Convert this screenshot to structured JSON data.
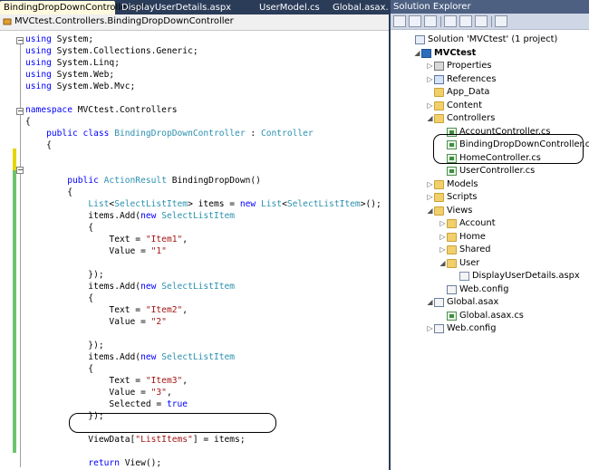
{
  "editor": {
    "tabs": [
      {
        "label": "BindingDropDownController.cs*",
        "active": true,
        "close": "×"
      },
      {
        "label": "DisplayUserDetails.aspx",
        "active": false
      },
      {
        "label": "UserModel.cs",
        "active": false
      },
      {
        "label": "Global.asax.cs",
        "active": false
      }
    ],
    "nav_path": "MVCtest.Controllers.BindingDropDownController",
    "code_lines": [
      [
        [
          "kw",
          "using"
        ],
        [
          "",
          " System;"
        ]
      ],
      [
        [
          "kw",
          "using"
        ],
        [
          "",
          " System.Collections.Generic;"
        ]
      ],
      [
        [
          "kw",
          "using"
        ],
        [
          "",
          " System.Linq;"
        ]
      ],
      [
        [
          "kw",
          "using"
        ],
        [
          "",
          " System.Web;"
        ]
      ],
      [
        [
          "kw",
          "using"
        ],
        [
          "",
          " System.Web.Mvc;"
        ]
      ],
      [],
      [
        [
          "kw",
          "namespace"
        ],
        [
          "",
          " MVCtest.Controllers"
        ]
      ],
      [
        [
          "",
          "{"
        ]
      ],
      [
        [
          "",
          "    "
        ],
        [
          "kw",
          "public class"
        ],
        [
          "",
          " "
        ],
        [
          "ty",
          "BindingDropDownController"
        ],
        [
          "",
          " : "
        ],
        [
          "ty",
          "Controller"
        ]
      ],
      [
        [
          "",
          "    {"
        ]
      ],
      [],
      [],
      [
        [
          "",
          "        "
        ],
        [
          "kw",
          "public"
        ],
        [
          "",
          " "
        ],
        [
          "ty",
          "ActionResult"
        ],
        [
          "",
          " BindingDropDown()"
        ]
      ],
      [
        [
          "",
          "        {"
        ]
      ],
      [
        [
          "",
          "            "
        ],
        [
          "ty",
          "List"
        ],
        [
          "",
          "<"
        ],
        [
          "ty",
          "SelectListItem"
        ],
        [
          "",
          "> items = "
        ],
        [
          "kw",
          "new"
        ],
        [
          "",
          " "
        ],
        [
          "ty",
          "List"
        ],
        [
          "",
          "<"
        ],
        [
          "ty",
          "SelectListItem"
        ],
        [
          "",
          ">();"
        ]
      ],
      [
        [
          "",
          "            items.Add("
        ],
        [
          "kw",
          "new"
        ],
        [
          "",
          " "
        ],
        [
          "ty",
          "SelectListItem"
        ]
      ],
      [
        [
          "",
          "            {"
        ]
      ],
      [
        [
          "",
          "                Text = "
        ],
        [
          "st",
          "\"Item1\""
        ],
        [
          "",
          ","
        ]
      ],
      [
        [
          "",
          "                Value = "
        ],
        [
          "st",
          "\"1\""
        ]
      ],
      [],
      [
        [
          "",
          "            });"
        ]
      ],
      [
        [
          "",
          "            items.Add("
        ],
        [
          "kw",
          "new"
        ],
        [
          "",
          " "
        ],
        [
          "ty",
          "SelectListItem"
        ]
      ],
      [
        [
          "",
          "            {"
        ]
      ],
      [
        [
          "",
          "                Text = "
        ],
        [
          "st",
          "\"Item2\""
        ],
        [
          "",
          ","
        ]
      ],
      [
        [
          "",
          "                Value = "
        ],
        [
          "st",
          "\"2\""
        ]
      ],
      [],
      [
        [
          "",
          "            });"
        ]
      ],
      [
        [
          "",
          "            items.Add("
        ],
        [
          "kw",
          "new"
        ],
        [
          "",
          " "
        ],
        [
          "ty",
          "SelectListItem"
        ]
      ],
      [
        [
          "",
          "            {"
        ]
      ],
      [
        [
          "",
          "                Text = "
        ],
        [
          "st",
          "\"Item3\""
        ],
        [
          "",
          ","
        ]
      ],
      [
        [
          "",
          "                Value = "
        ],
        [
          "st",
          "\"3\""
        ],
        [
          "",
          ","
        ]
      ],
      [
        [
          "",
          "                Selected = "
        ],
        [
          "kw",
          "true"
        ]
      ],
      [
        [
          "",
          "            });"
        ]
      ],
      [],
      [
        [
          "",
          "            ViewData["
        ],
        [
          "st",
          "\"ListItems\""
        ],
        [
          "",
          "] = items;"
        ]
      ],
      [],
      [
        [
          "",
          "            "
        ],
        [
          "kw",
          "return"
        ],
        [
          "",
          " View();"
        ]
      ],
      [
        [
          "",
          "        }"
        ]
      ]
    ]
  },
  "solution_explorer": {
    "title": "Solution Explorer",
    "nodes": [
      {
        "label": "Solution 'MVCtest' (1 project)",
        "icon": "sln",
        "expander": ""
      },
      {
        "label": "MVCtest",
        "icon": "proj",
        "expander": "◢",
        "bold": true
      },
      {
        "label": "Properties",
        "icon": "props",
        "expander": "▷"
      },
      {
        "label": "References",
        "icon": "refs",
        "expander": "▷"
      },
      {
        "label": "App_Data",
        "icon": "folder",
        "expander": ""
      },
      {
        "label": "Content",
        "icon": "folder",
        "expander": "▷"
      },
      {
        "label": "Controllers",
        "icon": "folder",
        "expander": "◢"
      },
      {
        "label": "AccountController.cs",
        "icon": "cs",
        "expander": ""
      },
      {
        "label": "BindingDropDownController.cs",
        "icon": "cs",
        "expander": ""
      },
      {
        "label": "HomeController.cs",
        "icon": "cs",
        "expander": ""
      },
      {
        "label": "UserController.cs",
        "icon": "cs",
        "expander": ""
      },
      {
        "label": "Models",
        "icon": "folder",
        "expander": "▷"
      },
      {
        "label": "Scripts",
        "icon": "folder",
        "expander": "▷"
      },
      {
        "label": "Views",
        "icon": "folder",
        "expander": "◢"
      },
      {
        "label": "Account",
        "icon": "folder",
        "expander": "▷"
      },
      {
        "label": "Home",
        "icon": "folder",
        "expander": "▷"
      },
      {
        "label": "Shared",
        "icon": "folder",
        "expander": "▷"
      },
      {
        "label": "User",
        "icon": "folder",
        "expander": "◢"
      },
      {
        "label": "DisplayUserDetails.aspx",
        "icon": "aspx",
        "expander": ""
      },
      {
        "label": "Web.config",
        "icon": "config",
        "expander": ""
      },
      {
        "label": "Global.asax",
        "icon": "asax",
        "expander": "◢"
      },
      {
        "label": "Global.asax.cs",
        "icon": "cs",
        "expander": ""
      },
      {
        "label": "Web.config",
        "icon": "config",
        "expander": "▷"
      }
    ]
  },
  "colors": {
    "keyword": "#0000ff",
    "type": "#2b91af",
    "string": "#a31515",
    "tab_bar": "#2b3c59",
    "active_tab": "#fff9dd"
  }
}
